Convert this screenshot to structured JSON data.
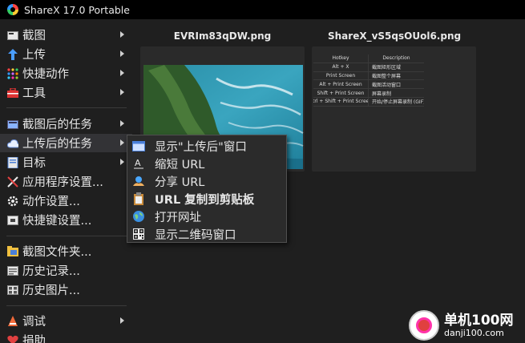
{
  "window": {
    "title": "ShareX 17.0 Portable"
  },
  "sidebar": {
    "items": [
      {
        "label": "截图",
        "icon": "capture-icon",
        "has_submenu": true
      },
      {
        "label": "上传",
        "icon": "upload-arrow-icon",
        "has_submenu": true
      },
      {
        "label": "快捷动作",
        "icon": "workflow-dots-icon",
        "has_submenu": true
      },
      {
        "label": "工具",
        "icon": "toolbox-icon",
        "has_submenu": true
      },
      {
        "label": "截图后的任务",
        "icon": "after-capture-icon",
        "has_submenu": true
      },
      {
        "label": "上传后的任务",
        "icon": "after-upload-cloud-icon",
        "has_submenu": true
      },
      {
        "label": "目标",
        "icon": "destination-icon",
        "has_submenu": true
      },
      {
        "label": "应用程序设置...",
        "icon": "app-settings-icon",
        "has_submenu": false
      },
      {
        "label": "动作设置...",
        "icon": "task-settings-gear-icon",
        "has_submenu": false
      },
      {
        "label": "快捷键设置...",
        "icon": "hotkey-keyboard-icon",
        "has_submenu": false
      },
      {
        "label": "截图文件夹...",
        "icon": "screenshots-folder-icon",
        "has_submenu": false
      },
      {
        "label": "历史记录...",
        "icon": "history-icon",
        "has_submenu": false
      },
      {
        "label": "历史图片...",
        "icon": "image-history-icon",
        "has_submenu": false
      },
      {
        "label": "调试",
        "icon": "debug-icon",
        "has_submenu": true
      },
      {
        "label": "捐助",
        "icon": "donate-heart-icon",
        "has_submenu": false
      }
    ]
  },
  "gallery": {
    "items": [
      {
        "filename": "EVRIm83qDW.png"
      },
      {
        "filename": "ShareX_vS5qsOUol6.png"
      }
    ],
    "table_preview": {
      "headers": [
        "Hotkey",
        "Description"
      ],
      "rows": [
        [
          "Alt + X",
          "截图矩形区域"
        ],
        [
          "Print Screen",
          "截图整个屏幕"
        ],
        [
          "Alt + Print Screen",
          "截图活动窗口"
        ],
        [
          "Shift + Print Screen",
          "屏幕录制"
        ],
        [
          "Ctrl + Shift + Print Screen",
          "开始/停止屏幕录制 (GIF)"
        ]
      ]
    }
  },
  "submenu": {
    "items": [
      {
        "label": "显示\"上传后\"窗口",
        "icon": "after-upload-window-icon",
        "bold": false
      },
      {
        "label": "缩短 URL",
        "icon": "shorten-url-icon",
        "bold": false
      },
      {
        "label": "分享 URL",
        "icon": "share-url-icon",
        "bold": false
      },
      {
        "label": "URL 复制到剪贴板",
        "icon": "copy-clipboard-icon",
        "bold": true
      },
      {
        "label": "打开网址",
        "icon": "open-url-globe-icon",
        "bold": false
      },
      {
        "label": "显示二维码窗口",
        "icon": "qr-code-icon",
        "bold": false
      }
    ]
  },
  "watermark": {
    "text": "单机100网",
    "url": "danji100.com"
  }
}
